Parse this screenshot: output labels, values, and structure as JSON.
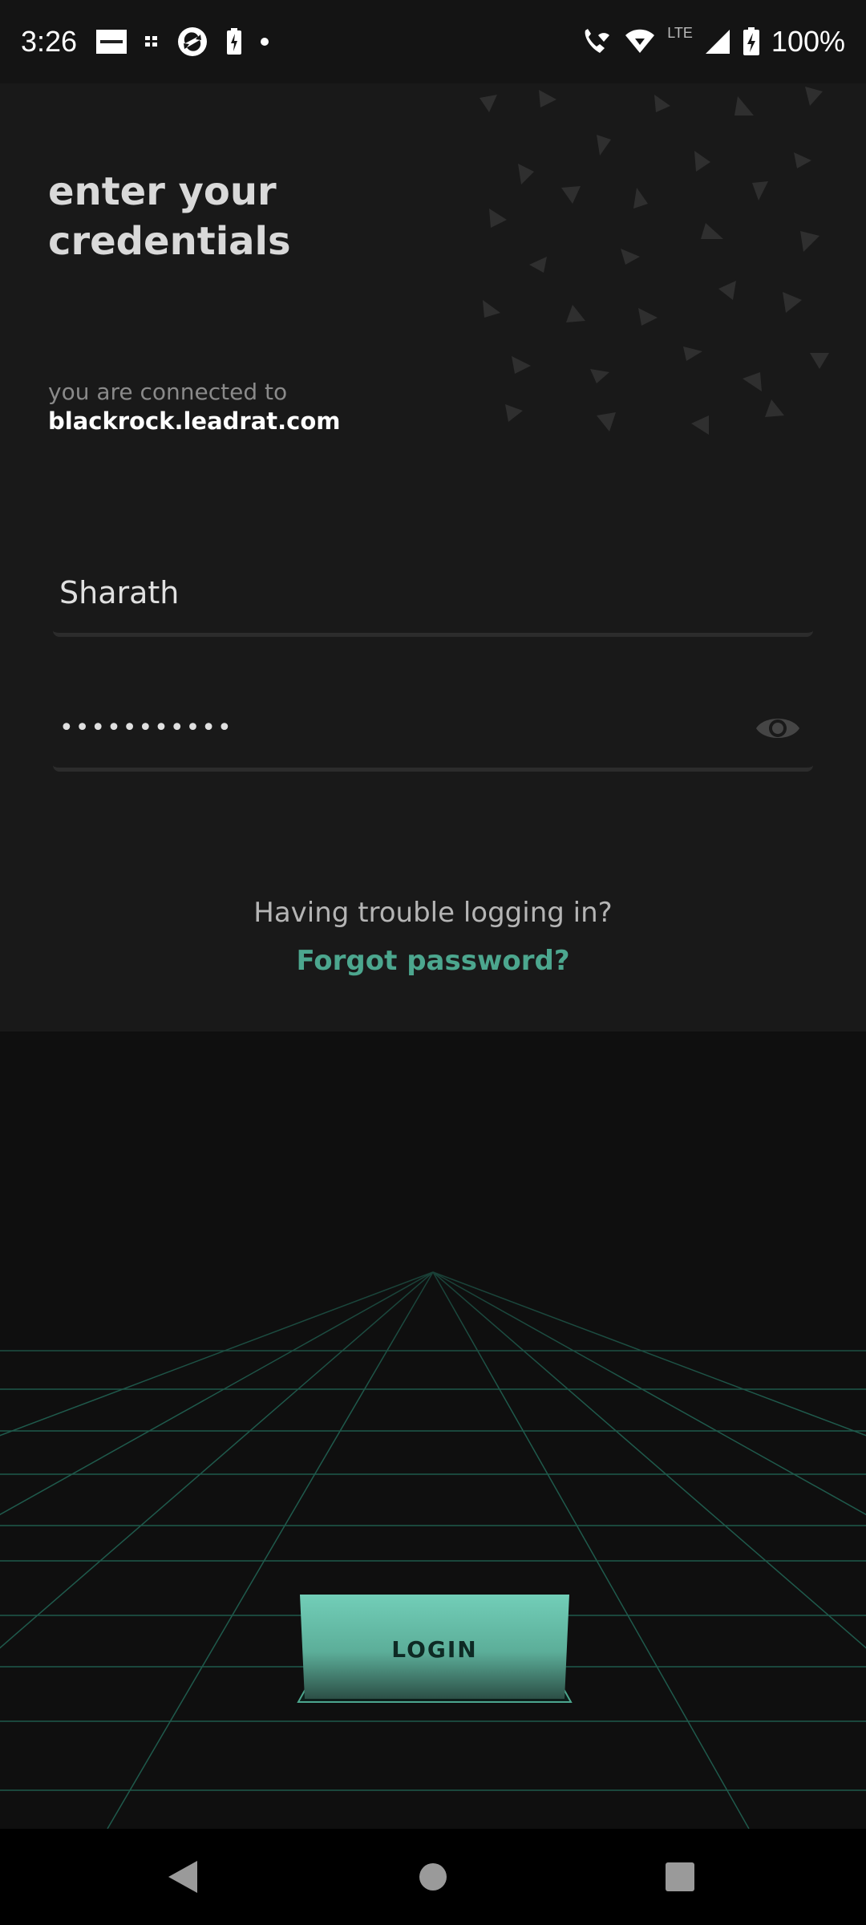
{
  "status_bar": {
    "time": "3:26",
    "network": "LTE",
    "battery": "100%",
    "left_icons": [
      "zomato-app-icon",
      "grid-notification-icon",
      "sync-app-icon",
      "battery-saver-icon",
      "dot-icon"
    ],
    "right_icons": [
      "wifi-calling-icon",
      "wifi-icon",
      "signal-icon",
      "battery-charging-icon"
    ]
  },
  "login": {
    "heading": "enter your credentials",
    "connected_label": "you are connected to",
    "connected_domain": "blackrock.leadrat.com",
    "username_value": "Sharath",
    "password_value": "•••••••••••",
    "show_password_icon": "eye-icon",
    "trouble_text": "Having trouble logging in?",
    "forgot_password": "Forgot password?",
    "login_button": "LOGIN"
  },
  "nav": {
    "back_icon": "back-triangle-icon",
    "home_icon": "home-circle-icon",
    "recents_icon": "recents-square-icon"
  },
  "colors": {
    "accent": "#4ca68e",
    "button_top": "#6fcbb4",
    "background_top": "#191919",
    "background_bottom": "#0f0f0f"
  }
}
